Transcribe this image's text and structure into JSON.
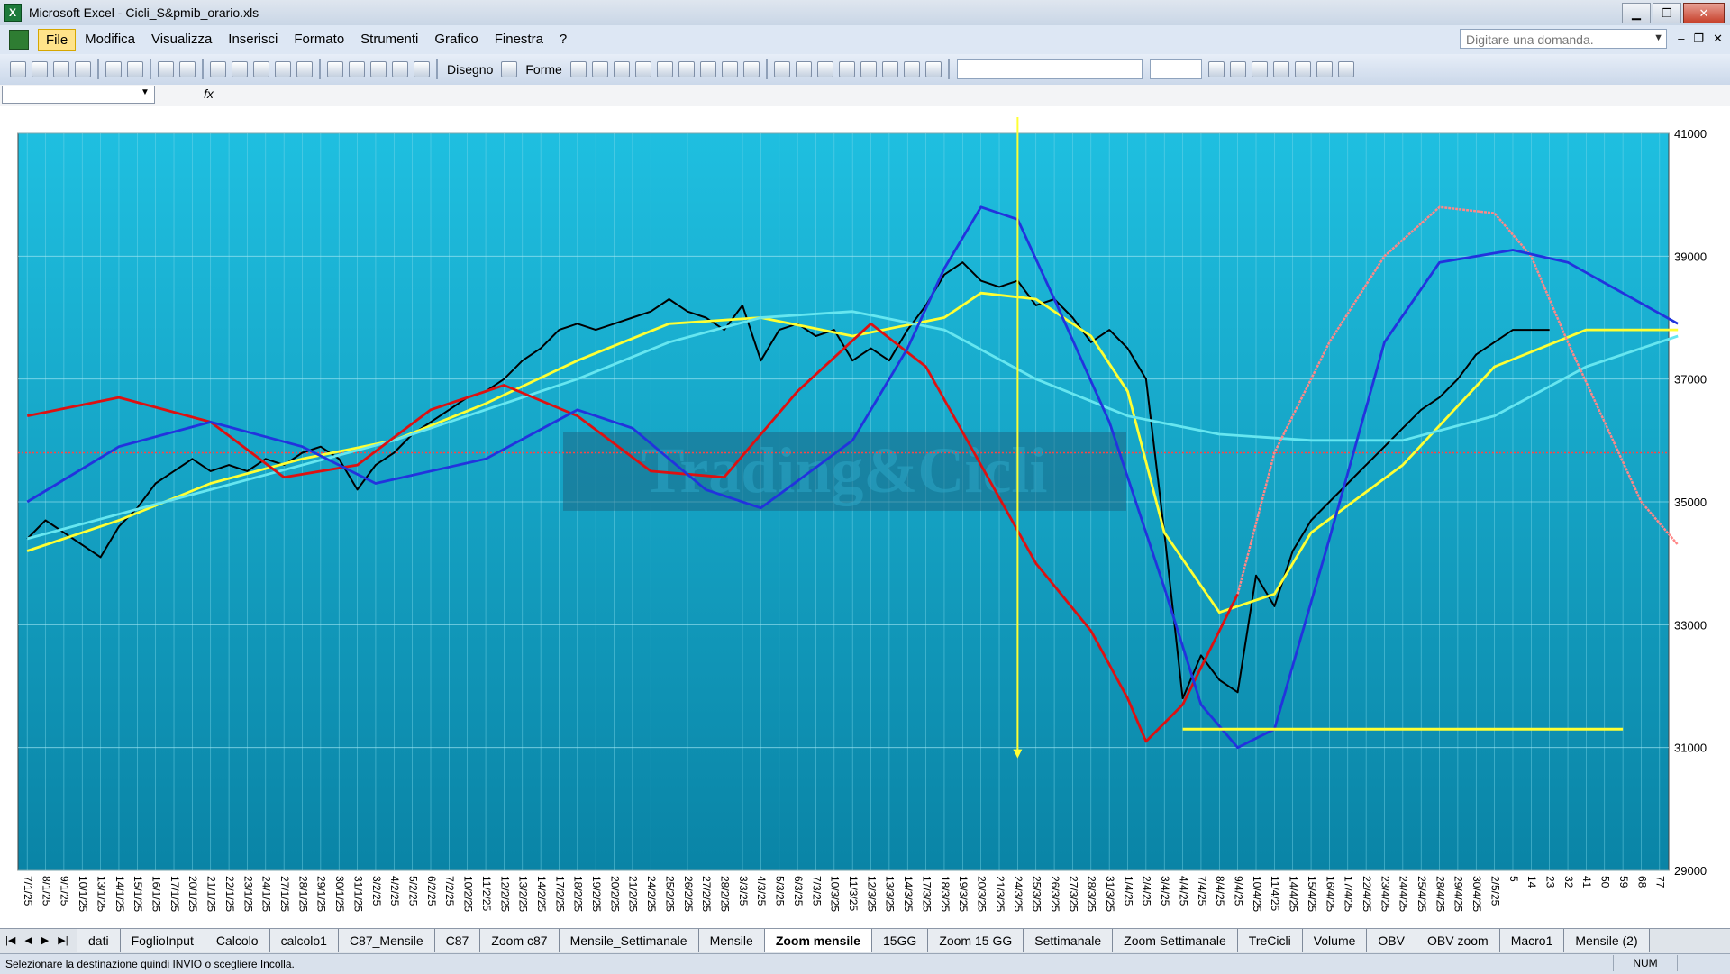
{
  "window": {
    "title": "Microsoft Excel - Cicli_S&pmib_orario.xls",
    "app_icon": "X"
  },
  "menu": {
    "items": [
      "File",
      "Modifica",
      "Visualizza",
      "Inserisci",
      "Formato",
      "Strumenti",
      "Grafico",
      "Finestra",
      "?"
    ],
    "active": "File",
    "ask_placeholder": "Digitare una domanda."
  },
  "toolbar": {
    "disegno_label": "Disegno",
    "forme_label": "Forme"
  },
  "formula_bar": {
    "fx": "fx"
  },
  "chart_data": {
    "type": "line",
    "watermark": "Trading&Cicli",
    "y_ticks": [
      29000,
      31000,
      33000,
      35000,
      37000,
      39000,
      41000
    ],
    "ylim": [
      29000,
      41000
    ],
    "red_ref_y": 35800,
    "yellow_support_y": 31300,
    "vline_label_index": 54,
    "x_labels": [
      "7/1/25",
      "8/1/25",
      "9/1/25",
      "10/1/25",
      "13/1/25",
      "14/1/25",
      "15/1/25",
      "16/1/25",
      "17/1/25",
      "20/1/25",
      "21/1/25",
      "22/1/25",
      "23/1/25",
      "24/1/25",
      "27/1/25",
      "28/1/25",
      "29/1/25",
      "30/1/25",
      "31/1/25",
      "3/2/25",
      "4/2/25",
      "5/2/25",
      "6/2/25",
      "7/2/25",
      "10/2/25",
      "11/2/25",
      "12/2/25",
      "13/2/25",
      "14/2/25",
      "17/2/25",
      "18/2/25",
      "19/2/25",
      "20/2/25",
      "21/2/25",
      "24/2/25",
      "25/2/25",
      "26/2/25",
      "27/2/25",
      "28/2/25",
      "3/3/25",
      "4/3/25",
      "5/3/25",
      "6/3/25",
      "7/3/25",
      "10/3/25",
      "11/3/25",
      "12/3/25",
      "13/3/25",
      "14/3/25",
      "17/3/25",
      "18/3/25",
      "19/3/25",
      "20/3/25",
      "21/3/25",
      "24/3/25",
      "25/3/25",
      "26/3/25",
      "27/3/25",
      "28/3/25",
      "31/3/25",
      "1/4/25",
      "2/4/25",
      "3/4/25",
      "4/4/25",
      "7/4/25",
      "8/4/25",
      "9/4/25",
      "10/4/25",
      "11/4/25",
      "14/4/25",
      "15/4/25",
      "16/4/25",
      "17/4/25",
      "22/4/25",
      "23/4/25",
      "24/4/25",
      "25/4/25",
      "28/4/25",
      "29/4/25",
      "30/4/25",
      "2/5/25",
      "5",
      "14",
      "23",
      "32",
      "41",
      "50",
      "59",
      "68",
      "77"
    ],
    "series": [
      {
        "color": "#000000",
        "values": [
          [
            0,
            34400
          ],
          [
            1,
            34700
          ],
          [
            2,
            34500
          ],
          [
            3,
            34300
          ],
          [
            4,
            34100
          ],
          [
            5,
            34600
          ],
          [
            6,
            34900
          ],
          [
            7,
            35300
          ],
          [
            8,
            35500
          ],
          [
            9,
            35700
          ],
          [
            10,
            35500
          ],
          [
            11,
            35600
          ],
          [
            12,
            35500
          ],
          [
            13,
            35700
          ],
          [
            14,
            35600
          ],
          [
            15,
            35800
          ],
          [
            16,
            35900
          ],
          [
            17,
            35700
          ],
          [
            18,
            35200
          ],
          [
            19,
            35600
          ],
          [
            20,
            35800
          ],
          [
            21,
            36100
          ],
          [
            22,
            36300
          ],
          [
            23,
            36500
          ],
          [
            24,
            36700
          ],
          [
            25,
            36800
          ],
          [
            26,
            37000
          ],
          [
            27,
            37300
          ],
          [
            28,
            37500
          ],
          [
            29,
            37800
          ],
          [
            30,
            37900
          ],
          [
            31,
            37800
          ],
          [
            32,
            37900
          ],
          [
            33,
            38000
          ],
          [
            34,
            38100
          ],
          [
            35,
            38300
          ],
          [
            36,
            38100
          ],
          [
            37,
            38000
          ],
          [
            38,
            37800
          ],
          [
            39,
            38200
          ],
          [
            40,
            37300
          ],
          [
            41,
            37800
          ],
          [
            42,
            37900
          ],
          [
            43,
            37700
          ],
          [
            44,
            37800
          ],
          [
            45,
            37300
          ],
          [
            46,
            37500
          ],
          [
            47,
            37300
          ],
          [
            48,
            37800
          ],
          [
            49,
            38200
          ],
          [
            50,
            38700
          ],
          [
            51,
            38900
          ],
          [
            52,
            38600
          ],
          [
            53,
            38500
          ],
          [
            54,
            38600
          ],
          [
            55,
            38200
          ],
          [
            56,
            38300
          ],
          [
            57,
            38000
          ],
          [
            58,
            37600
          ],
          [
            59,
            37800
          ],
          [
            60,
            37500
          ],
          [
            61,
            37000
          ],
          [
            62,
            34500
          ],
          [
            63,
            31800
          ],
          [
            64,
            32500
          ],
          [
            65,
            32100
          ],
          [
            66,
            31900
          ],
          [
            67,
            33800
          ],
          [
            68,
            33300
          ],
          [
            69,
            34200
          ],
          [
            70,
            34700
          ],
          [
            71,
            35000
          ],
          [
            72,
            35300
          ],
          [
            73,
            35600
          ],
          [
            74,
            35900
          ],
          [
            75,
            36200
          ],
          [
            76,
            36500
          ],
          [
            77,
            36700
          ],
          [
            78,
            37000
          ],
          [
            79,
            37400
          ],
          [
            80,
            37600
          ],
          [
            81,
            37800
          ],
          [
            82,
            37800
          ],
          [
            83,
            37800
          ]
        ]
      },
      {
        "color": "#ffff33",
        "values": [
          [
            0,
            34200
          ],
          [
            5,
            34700
          ],
          [
            10,
            35300
          ],
          [
            15,
            35700
          ],
          [
            20,
            36000
          ],
          [
            25,
            36600
          ],
          [
            30,
            37300
          ],
          [
            35,
            37900
          ],
          [
            40,
            38000
          ],
          [
            45,
            37700
          ],
          [
            50,
            38000
          ],
          [
            52,
            38400
          ],
          [
            55,
            38300
          ],
          [
            58,
            37700
          ],
          [
            60,
            36800
          ],
          [
            62,
            34500
          ],
          [
            65,
            33200
          ],
          [
            68,
            33500
          ],
          [
            70,
            34500
          ],
          [
            75,
            35600
          ],
          [
            80,
            37200
          ],
          [
            85,
            37800
          ],
          [
            90,
            37800
          ]
        ]
      },
      {
        "color": "#66e6f0",
        "values": [
          [
            0,
            34400
          ],
          [
            10,
            35200
          ],
          [
            20,
            36000
          ],
          [
            30,
            37000
          ],
          [
            35,
            37600
          ],
          [
            40,
            38000
          ],
          [
            45,
            38100
          ],
          [
            50,
            37800
          ],
          [
            55,
            37000
          ],
          [
            60,
            36400
          ],
          [
            65,
            36100
          ],
          [
            70,
            36000
          ],
          [
            75,
            36000
          ],
          [
            80,
            36400
          ],
          [
            85,
            37200
          ],
          [
            90,
            37700
          ]
        ]
      },
      {
        "color": "#dd1111",
        "values": [
          [
            0,
            36400
          ],
          [
            5,
            36700
          ],
          [
            10,
            36300
          ],
          [
            14,
            35400
          ],
          [
            18,
            35600
          ],
          [
            22,
            36500
          ],
          [
            26,
            36900
          ],
          [
            30,
            36400
          ],
          [
            34,
            35500
          ],
          [
            38,
            35400
          ],
          [
            42,
            36800
          ],
          [
            46,
            37900
          ],
          [
            49,
            37200
          ],
          [
            52,
            35600
          ],
          [
            55,
            34000
          ],
          [
            58,
            32900
          ],
          [
            60,
            31800
          ],
          [
            61,
            31100
          ],
          [
            63,
            31700
          ],
          [
            64,
            32300
          ],
          [
            66,
            33500
          ]
        ]
      },
      {
        "color": "#ff8888",
        "values": [
          [
            66,
            33500
          ],
          [
            68,
            35800
          ],
          [
            71,
            37600
          ],
          [
            74,
            39000
          ],
          [
            77,
            39800
          ],
          [
            80,
            39700
          ],
          [
            82,
            39000
          ],
          [
            84,
            37600
          ],
          [
            86,
            36300
          ],
          [
            88,
            35000
          ],
          [
            90,
            34300
          ]
        ]
      },
      {
        "color": "#2233dd",
        "values": [
          [
            0,
            35000
          ],
          [
            5,
            35900
          ],
          [
            10,
            36300
          ],
          [
            15,
            35900
          ],
          [
            19,
            35300
          ],
          [
            25,
            35700
          ],
          [
            30,
            36500
          ],
          [
            33,
            36200
          ],
          [
            37,
            35200
          ],
          [
            40,
            34900
          ],
          [
            45,
            36000
          ],
          [
            48,
            37500
          ],
          [
            50,
            38800
          ],
          [
            52,
            39800
          ],
          [
            54,
            39600
          ],
          [
            56,
            38300
          ],
          [
            59,
            36300
          ],
          [
            62,
            33600
          ],
          [
            64,
            31700
          ],
          [
            66,
            31000
          ],
          [
            68,
            31300
          ],
          [
            71,
            34400
          ],
          [
            74,
            37600
          ],
          [
            77,
            38900
          ],
          [
            81,
            39100
          ],
          [
            84,
            38900
          ],
          [
            90,
            37900
          ]
        ]
      }
    ]
  },
  "sheet_tabs": {
    "items": [
      "dati",
      "FoglioInput",
      "Calcolo",
      "calcolo1",
      "C87_Mensile",
      "C87",
      "Zoom c87",
      "Mensile_Settimanale",
      "Mensile",
      "Zoom mensile",
      "15GG",
      "Zoom 15 GG",
      "Settimanale",
      "Zoom Settimanale",
      "TreCicli",
      "Volume",
      "OBV",
      "OBV zoom",
      "Macro1",
      "Mensile (2)"
    ],
    "active": "Zoom mensile"
  },
  "status": {
    "text": "Selezionare la destinazione quindi INVIO o scegliere Incolla.",
    "num": "NUM"
  },
  "colors": {
    "plot_top": "#1fbfe0",
    "plot_bottom": "#0a84a6",
    "red_ref": "#ff4444",
    "support": "#ffff33"
  }
}
